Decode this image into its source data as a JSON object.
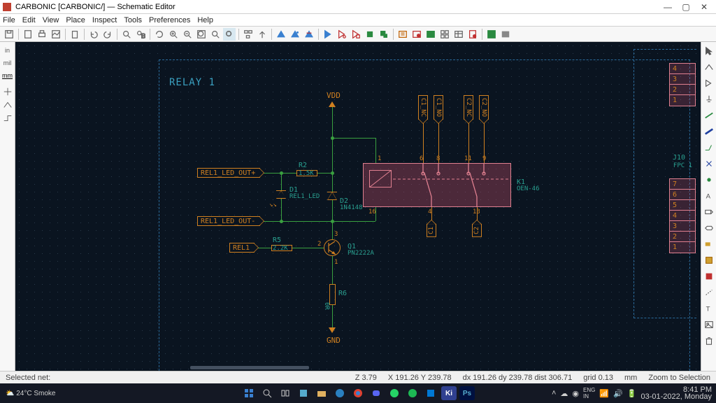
{
  "title": "CARBONIC [CARBONIC/] — Schematic Editor",
  "menu": [
    "File",
    "Edit",
    "View",
    "Place",
    "Inspect",
    "Tools",
    "Preferences",
    "Help"
  ],
  "left_units": {
    "in": "in",
    "mil": "mil",
    "mm": "mm"
  },
  "sheet_title": "RELAY 1",
  "power": {
    "vdd": "VDD",
    "gnd": "GND"
  },
  "netlabels": {
    "led_out_p": "REL1_LED_OUT+",
    "led_out_n": "REL1_LED_OUT-",
    "rel1": "REL1",
    "c1_nc": "C1_NC",
    "c1_no": "C1_NO",
    "c2_nc": "C2_NC",
    "c2_no": "C2_NO",
    "c1": "C1",
    "c2": "C2"
  },
  "components": {
    "r2": {
      "ref": "R2",
      "val": "1.5K"
    },
    "r5": {
      "ref": "R5",
      "val": "2.2K"
    },
    "r6": {
      "ref": "R6",
      "val": "0R"
    },
    "d1": {
      "ref": "D1",
      "val": "REL1_LED"
    },
    "d2": {
      "ref": "D2",
      "val": "1N4148"
    },
    "q1": {
      "ref": "Q1",
      "val": "PN2222A"
    },
    "k1": {
      "ref": "K1",
      "val": "OEN-46"
    },
    "j10": {
      "ref": "J10",
      "val": "FPC 1"
    }
  },
  "connector_pins_top": [
    "4",
    "3",
    "2",
    "1"
  ],
  "connector_pins_bot": [
    "7",
    "6",
    "5",
    "4",
    "3",
    "2",
    "1"
  ],
  "status": {
    "selected": "Selected net:",
    "z": "Z 3.79",
    "xy": "X 191.26  Y 239.78",
    "dxy": "dx 191.26  dy 239.78  dist 306.71",
    "grid": "grid 0.13",
    "unit": "mm",
    "zoom": "Zoom to Selection"
  },
  "taskbar": {
    "time": "8:41 PM",
    "date": "03-01-2022, Monday",
    "weather": "⛅ 24°C Smoke"
  }
}
